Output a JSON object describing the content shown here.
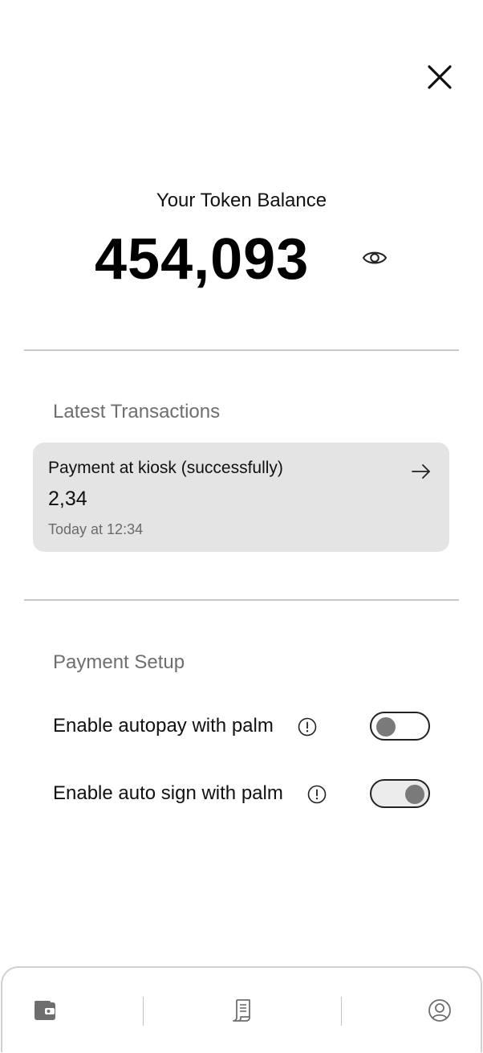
{
  "balance": {
    "label": "Your Token Balance",
    "value": "454,093"
  },
  "transactions": {
    "section_title": "Latest Transactions",
    "items": [
      {
        "title": "Payment at kiosk (successfully)",
        "amount": "2,34",
        "time": "Today at 12:34"
      }
    ]
  },
  "payment_setup": {
    "section_title": "Payment Setup",
    "settings": [
      {
        "label": "Enable autopay with palm",
        "enabled": false
      },
      {
        "label": "Enable auto sign with palm",
        "enabled": true
      }
    ]
  },
  "icons": {
    "close": "close-icon",
    "visibility": "eye-icon",
    "transaction_open": "arrow-right-icon",
    "info": "info-icon",
    "nav": [
      "wallet-icon",
      "receipt-icon",
      "profile-icon"
    ]
  },
  "colors": {
    "card_background": "#e4e4e4",
    "knob": "#7a7a7a",
    "muted_text": "#6e6e6e"
  }
}
